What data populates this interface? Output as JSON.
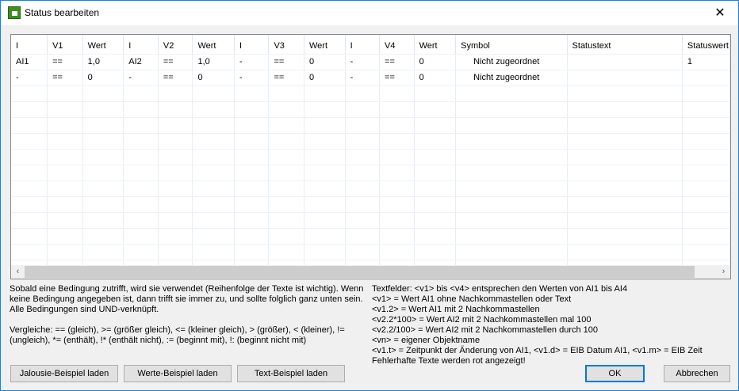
{
  "window": {
    "title": "Status bearbeiten",
    "close_label": "✕"
  },
  "table": {
    "columns": [
      "I",
      "V1",
      "Wert",
      "I",
      "V2",
      "Wert",
      "I",
      "V3",
      "Wert",
      "I",
      "V4",
      "Wert",
      "Symbol",
      "Statustext",
      "Statuswert"
    ],
    "rows": [
      [
        "AI1",
        "==",
        "1,0",
        "AI2",
        "==",
        "1,0",
        "-",
        "==",
        "0",
        "-",
        "==",
        "0",
        "Nicht zugeordnet",
        "",
        "1"
      ],
      [
        "-",
        "==",
        "0",
        "-",
        "==",
        "0",
        "-",
        "==",
        "0",
        "-",
        "==",
        "0",
        "Nicht zugeordnet",
        "",
        ""
      ]
    ]
  },
  "scrollbar": {
    "left_arrow": "‹",
    "right_arrow": "›"
  },
  "help_left": [
    "Sobald eine Bedingung zutrifft, wird sie verwendet (Reihenfolge der Texte ist wichtig). Wenn",
    "keine Bedingung angegeben ist, dann trifft sie immer zu, und sollte folglich ganz unten sein.",
    "Alle Bedingungen sind UND-verknüpft.",
    "",
    "Vergleiche: == (gleich), >= (größer gleich), <= (kleiner gleich), > (größer), < (kleiner), !=",
    "(ungleich), *= (enthält), !* (enthält nicht), := (beginnt mit), !: (beginnt nicht mit)"
  ],
  "help_right": [
    "Textfelder: <v1> bis <v4> entsprechen den Werten von AI1 bis AI4",
    "<v1> = Wert AI1 ohne Nachkommastellen oder Text",
    "<v1.2> = Wert AI1 mit 2 Nachkommastellen",
    "<v2.2*100> = Wert AI2 mit 2 Nachkommastellen mal 100",
    "<v2.2/100> = Wert AI2 mit 2 Nachkommastellen durch 100",
    "<vn> = eigener Objektname",
    "<v1.t> = Zeitpunkt der Änderung von AI1, <v1.d> = EIB Datum AI1, <v1.m> = EIB Zeit",
    "Fehlerhafte Texte werden rot angezeigt!"
  ],
  "buttons": {
    "jalousie": "Jalousie-Beispiel laden",
    "werte": "Werte-Beispiel laden",
    "text": "Text-Beispiel laden",
    "ok": "OK",
    "cancel": "Abbrechen"
  }
}
